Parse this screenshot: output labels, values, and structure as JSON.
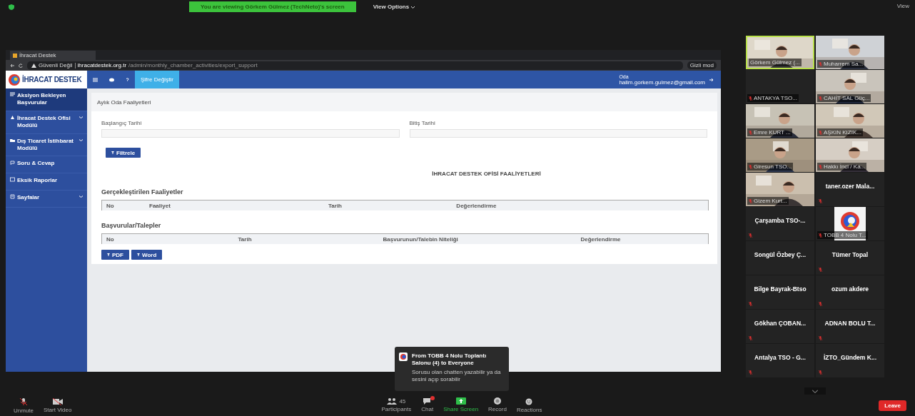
{
  "zoom_top": {
    "banner": "You are viewing Görkem Gülmez (TechNeto)'s screen",
    "view_options": "View Options",
    "view": "View"
  },
  "browser": {
    "tab": "İhracat Destek",
    "security": "Güvenli Değil",
    "domain": "ihracatdestek.org.tr",
    "path": "/admin/monthly_chamber_activities/export_support",
    "incognito": "Gizli mod"
  },
  "app_header": {
    "logo": "İHRACAT DESTEK",
    "password_button": "Şifre Değiştir",
    "user_name": "Oda",
    "user_email": "halim.gorkem.gulmez@gmail.com"
  },
  "sidebar": {
    "items": [
      {
        "label": "Aksiyon Bekleyen Başvurular",
        "selected": true,
        "expandable": false
      },
      {
        "label": "İhracat Destek Ofisi Modülü",
        "selected": false,
        "expandable": true
      },
      {
        "label": "Dış Ticaret İstihbarat Modülü",
        "selected": false,
        "expandable": true
      },
      {
        "label": "Soru & Cevap",
        "selected": false,
        "expandable": false
      },
      {
        "label": "Eksik Raporlar",
        "selected": false,
        "expandable": false
      },
      {
        "label": "Sayfalar",
        "selected": false,
        "expandable": true
      }
    ]
  },
  "panel": {
    "title": "Aylık Oda Faaliyetleri",
    "start_label": "Başlangıç Tarihi",
    "end_label": "Bitiş Tarihi",
    "filter_button": "Filtrele",
    "heading": "İHRACAT DESTEK OFİSİ FAALİYETLERİ",
    "sections": [
      {
        "title": "Gerçekleştirilen Faaliyetler",
        "columns": [
          "No",
          "Faaliyet",
          "Tarih",
          "Değerlendirme"
        ]
      },
      {
        "title": "Başvurular/Talepler",
        "columns": [
          "No",
          "Tarih",
          "Başvurunun/Talebin Niteliği",
          "Değerlendirme"
        ]
      }
    ],
    "export_buttons": [
      "PDF",
      "Word"
    ]
  },
  "gallery": {
    "tiles": [
      {
        "kind": "video",
        "name": "Görkem Gülmez (...",
        "muted": false,
        "speaking": true
      },
      {
        "kind": "video",
        "name": "Muharrem Sa...",
        "muted": true,
        "speaking": false
      },
      {
        "kind": "blank",
        "name": "ANTAKYA TSO...",
        "muted": true,
        "speaking": false
      },
      {
        "kind": "video",
        "name": "CAHİT SAL Güç...",
        "muted": true,
        "speaking": false
      },
      {
        "kind": "video",
        "name": "Emre KURT ...",
        "muted": true,
        "speaking": false
      },
      {
        "kind": "video",
        "name": "AŞKIN KIZIK...",
        "muted": true,
        "speaking": false
      },
      {
        "kind": "video",
        "name": "Giresun TSO...",
        "muted": true,
        "speaking": false
      },
      {
        "kind": "video",
        "name": "Hakkı İnci / Ka...",
        "muted": true,
        "speaking": false
      },
      {
        "kind": "video",
        "name": "Gizem Kurt...",
        "muted": true,
        "speaking": false
      },
      {
        "kind": "name",
        "name": "taner.ozer  Mala...",
        "muted": true,
        "speaking": false
      },
      {
        "kind": "name",
        "name": "Çarşamba TSO-...",
        "muted": true,
        "speaking": false
      },
      {
        "kind": "logo",
        "name": "TOBB 4 Nolu T...",
        "muted": true,
        "speaking": false
      },
      {
        "kind": "name",
        "name": "Songül Özbey Ç...",
        "muted": false,
        "speaking": false
      },
      {
        "kind": "name",
        "name": "Tümer Topal",
        "muted": true,
        "speaking": false
      },
      {
        "kind": "name",
        "name": "Bilge Bayrak-Btso",
        "muted": true,
        "speaking": false
      },
      {
        "kind": "name",
        "name": "ozum akdere",
        "muted": true,
        "speaking": false
      },
      {
        "kind": "name",
        "name": "Gökhan ÇOBAN...",
        "muted": true,
        "speaking": false
      },
      {
        "kind": "name",
        "name": "ADNAN BOLU T...",
        "muted": true,
        "speaking": false
      },
      {
        "kind": "name",
        "name": "Antalya TSO - G...",
        "muted": true,
        "speaking": false
      },
      {
        "kind": "name",
        "name": "İZTO_Gündem K...",
        "muted": true,
        "speaking": false
      }
    ]
  },
  "chat_popup": {
    "sender": "From TOBB 4 Nolu Toplantı Salonu (4) to Everyone",
    "message": "Sorusu olan chatten yazabilir ya da sesini açıp sorabilir"
  },
  "toolbar": {
    "left": [
      {
        "kind": "mic-off",
        "label": "Unmute"
      },
      {
        "kind": "video-off",
        "label": "Start Video"
      }
    ],
    "center": [
      {
        "kind": "participants",
        "label": "Participants",
        "count": "45"
      },
      {
        "kind": "chat",
        "label": "Chat",
        "notification": true
      },
      {
        "kind": "share",
        "label": "Share Screen"
      },
      {
        "kind": "record",
        "label": "Record"
      },
      {
        "kind": "reactions",
        "label": "Reactions"
      }
    ],
    "leave": "Leave"
  }
}
